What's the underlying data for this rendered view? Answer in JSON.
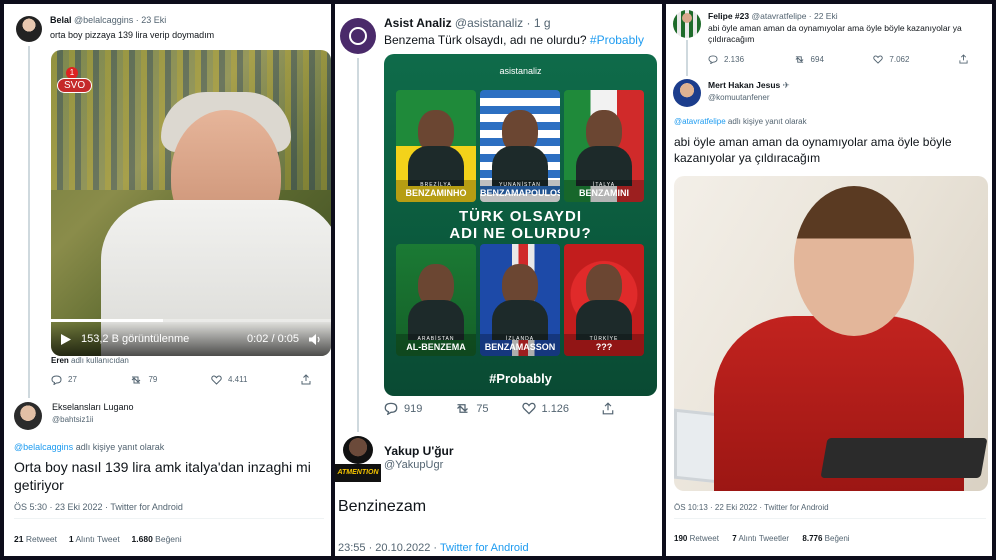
{
  "panel1": {
    "top_tweet": {
      "name": "Belal",
      "handle": "@belalcaggins",
      "time": "· 23 Eki",
      "text": "orta boy pizzaya 139 lira verip doymadım",
      "video": {
        "live_badge": "1",
        "channel": "SVO",
        "views": "153,2 B görüntülenme",
        "time": "0:02 / 0:05",
        "progress_percent": 40
      },
      "attribution_user": "Eren",
      "attribution_rest": " adlı kullanıcıdan",
      "stats": {
        "replies": "27",
        "retweets": "79",
        "likes": "4.411"
      }
    },
    "reply": {
      "name": "Ekselansları Lugano",
      "handle": "@bahtsiz1ii",
      "reply_to_handle": "@belalcaggins",
      "reply_to_rest": " adlı kişiye yanıt olarak",
      "text": "Orta boy nasıl 139 lira amk italya'dan inzaghi mi getiriyor",
      "meta": "ÖS 5:30 · 23 Eki 2022 · Twitter for Android",
      "retweets_count": "21",
      "retweets_label": " Retweet",
      "quotes_count": "1",
      "quotes_label": " Alıntı Tweet",
      "likes_count": "1.680",
      "likes_label": " Beğeni"
    }
  },
  "panel2": {
    "top_tweet": {
      "name": "Asist Analiz",
      "handle": "@asistanaliz",
      "time": "· 1 g",
      "text_main": "Benzema Türk olsaydı, adı ne olurdu? ",
      "hashtag": "#Probably",
      "poster": {
        "logo": "asistanaliz",
        "title_line1": "TÜRK OLSAYDI",
        "title_line2": "ADI NE OLURDU?",
        "hashtag": "#Probably",
        "tiles": [
          {
            "country": "BREZİLYA",
            "nick": "BENZAMINHO"
          },
          {
            "country": "YUNANİSTAN",
            "nick": "BENZAMAPOULOS"
          },
          {
            "country": "İTALYA",
            "nick": "BENZAMINI"
          },
          {
            "country": "ARABİSTAN",
            "nick": "AL-BENZEMA"
          },
          {
            "country": "İZLANDA",
            "nick": "BENZAMASSON"
          },
          {
            "country": "TÜRKİYE",
            "nick": "???"
          }
        ]
      },
      "stats": {
        "replies": "919",
        "retweets": "75",
        "likes": "1.126"
      }
    },
    "reply": {
      "name": "Yakup U'ğur",
      "handle": "@YakupUgr",
      "avatar_text": "ATMENTION",
      "text": "Benzinezam",
      "meta_time": "23:55 · 20.10.2022 · ",
      "meta_source": "Twitter for Android"
    }
  },
  "panel3": {
    "top_tweet": {
      "name": "Felipe #23",
      "handle": "@atavratfelipe",
      "time": "· 22 Eki",
      "text": "abi öyle aman aman da oynamıyolar ama öyle böyle kazanıyolar ya çıldıracağım",
      "stats": {
        "replies": "2.136",
        "retweets": "694",
        "likes": "7.062"
      }
    },
    "reply": {
      "name": "Mert Hakan Jesus",
      "name_badge": "✈",
      "handle": "@komuutanfener",
      "reply_to_handle": "@atavratfelipe",
      "reply_to_rest": " adlı kişiye yanıt olarak",
      "text": "abi öyle aman aman da oynamıyolar ama öyle böyle kazanıyolar ya çıldıracağım",
      "meta": "ÖS 10:13 · 22 Eki 2022 · Twitter for Android",
      "retweets_count": "190",
      "retweets_label": " Retweet",
      "quotes_count": "7",
      "quotes_label": " Alıntı Tweetler",
      "likes_count": "8.776",
      "likes_label": " Beğeni"
    }
  },
  "colors": {
    "link": "#1d9bf0",
    "secondary": "#536471",
    "background": "#0d0d1a",
    "poster_green": "#0f6b4a"
  }
}
